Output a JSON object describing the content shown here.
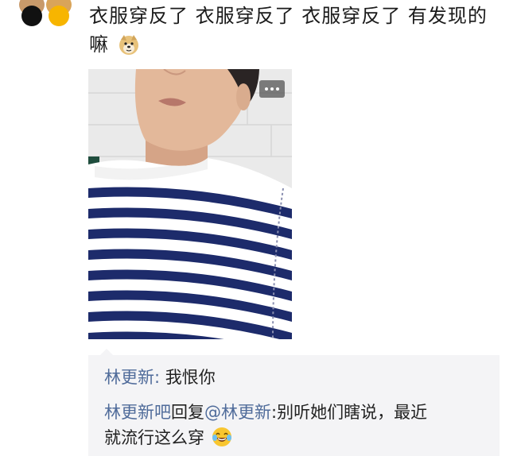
{
  "post": {
    "text": "衣服穿反了 衣服穿反了 衣服穿反了 有发现的嘛",
    "emoji": "doge-emoji"
  },
  "photo": {
    "alt": "striped shirt selfie",
    "more_button": "more-icon"
  },
  "comments": {
    "c1": {
      "name": "林更新",
      "sep": ": ",
      "text": "我恨你"
    },
    "c2": {
      "name": "林更新吧",
      "reply": "回复",
      "mention": "@林更新",
      "sep": ":",
      "text_line1": "别听她们瞎说，最近",
      "text_line2": "就流行这么穿",
      "emoji": "laughing-tears-emoji"
    }
  },
  "colors": {
    "name_blue": "#4f6b9a",
    "comment_bg": "#f4f4f6",
    "stripe_navy": "#1d2b6b"
  }
}
